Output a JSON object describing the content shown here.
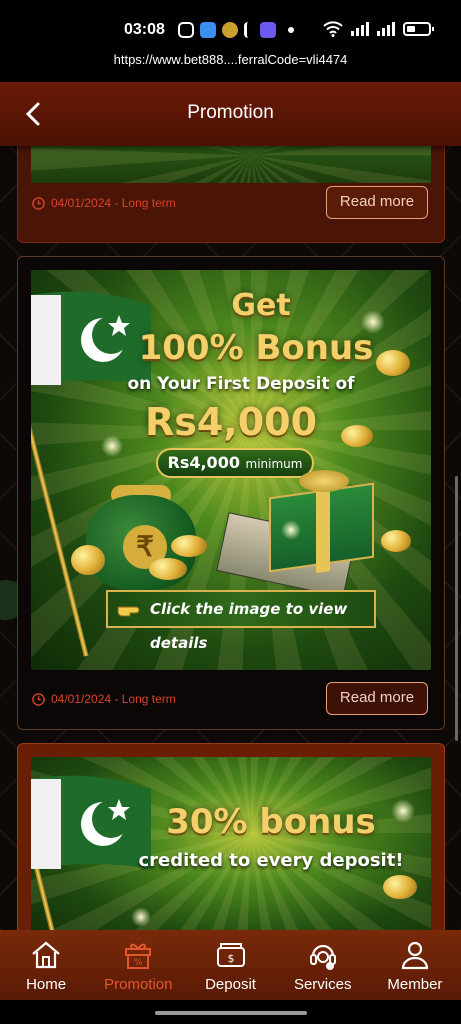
{
  "status_bar": {
    "time": "03:08",
    "icons": [
      "instagram-icon",
      "app-icon",
      "app-icon",
      "app-icon",
      "app-icon",
      "dot-icon",
      "wifi-icon",
      "signal-icon",
      "signal-icon",
      "battery-icon"
    ]
  },
  "url": "https://www.bet888....ferralCode=vli4474",
  "header": {
    "title": "Promotion"
  },
  "promotions": [
    {
      "date": "04/01/2024 - Long term",
      "read_more": "Read more"
    },
    {
      "banner": {
        "line1": "Get",
        "line2": "100% Bonus",
        "line3": "on Your First Deposit of",
        "line4": "Rs4,000",
        "pill_amount": "Rs4,000",
        "pill_label": "minimum",
        "cta": "Click the image to view details"
      },
      "date": "04/01/2024 - Long term",
      "read_more": "Read more"
    },
    {
      "banner": {
        "line1": "30% bonus",
        "line2": "credited to every deposit!"
      }
    }
  ],
  "bottom_nav": [
    {
      "label": "Home",
      "icon": "home-icon",
      "active": false
    },
    {
      "label": "Promotion",
      "icon": "gift-icon",
      "active": true
    },
    {
      "label": "Deposit",
      "icon": "wallet-icon",
      "active": false
    },
    {
      "label": "Services",
      "icon": "headset-icon",
      "active": false
    },
    {
      "label": "Member",
      "icon": "user-icon",
      "active": false
    }
  ],
  "colors": {
    "accent": "#e0572e",
    "header_bg": "#6b1a06",
    "date_red": "#d7442a"
  }
}
